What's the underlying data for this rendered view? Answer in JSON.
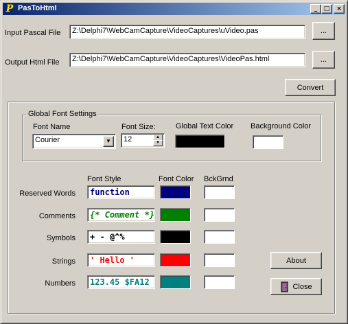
{
  "window": {
    "title": "PasToHtml",
    "icon_glyph": "P",
    "minimize_label": "_",
    "maximize_label": "□",
    "close_label": "×"
  },
  "input": {
    "label": "Input Pascal File",
    "path": "Z:\\Delphi7\\WebCamCapture\\VideoCaptures\\uVideo.pas",
    "browse_label": "..."
  },
  "output": {
    "label": "Output Html File",
    "path": "Z:\\Delphi7\\WebCamCapture\\VideoCaptures\\VideoPas.html",
    "browse_label": "..."
  },
  "convert_label": "Convert",
  "global_font": {
    "caption": "Global Font Settings",
    "font_name_label": "Font Name",
    "font_name_value": "Courier",
    "font_size_label": "Font Size:",
    "font_size_value": "12",
    "text_color_label": "Global Text Color",
    "text_color": "#000000",
    "bg_color_label": "Background Color",
    "bg_color": "#ffffff"
  },
  "syntax": {
    "col_font_style": "Font Style",
    "col_font_color": "Font Color",
    "col_bckgrnd": "BckGrnd",
    "rows": [
      {
        "label": "Reserved Words",
        "sample": "function",
        "color": "#000080",
        "bg": "#ffffff",
        "italic": false
      },
      {
        "label": "Comments",
        "sample": "{* Comment  *}",
        "color": "#008000",
        "bg": "#ffffff",
        "italic": true
      },
      {
        "label": "Symbols",
        "sample": "+ - @^%",
        "color": "#000000",
        "bg": "#ffffff",
        "italic": false
      },
      {
        "label": "Strings",
        "sample": "' Hello '",
        "color": "#ff0000",
        "bg": "#ffffff",
        "italic": false
      },
      {
        "label": "Numbers",
        "sample": "123.45 $FA12",
        "color": "#008080",
        "bg": "#ffffff",
        "italic": false
      }
    ]
  },
  "about_label": "About",
  "close_label": "Close",
  "close_icon": "door-exit-icon"
}
